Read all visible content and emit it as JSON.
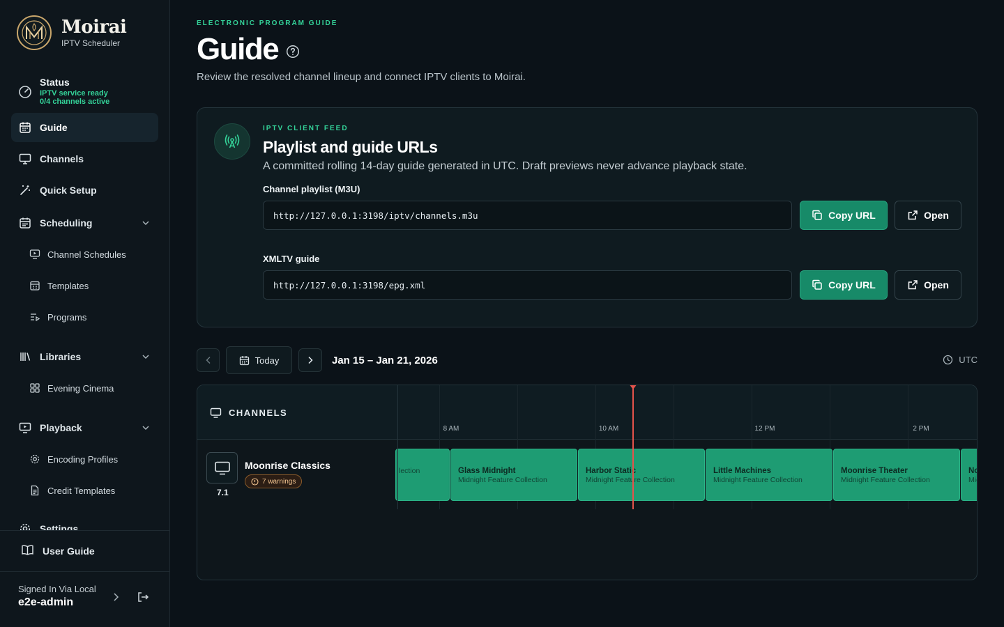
{
  "brand": {
    "name": "Moirai",
    "subtitle": "IPTV Scheduler"
  },
  "status": {
    "title": "Status",
    "line1": "IPTV service ready",
    "line2": "0/4 channels active"
  },
  "nav": {
    "guide": "Guide",
    "channels": "Channels",
    "quick_setup": "Quick Setup",
    "scheduling": "Scheduling",
    "channel_schedules": "Channel Schedules",
    "templates": "Templates",
    "programs": "Programs",
    "libraries": "Libraries",
    "evening_cinema": "Evening Cinema",
    "playback": "Playback",
    "encoding_profiles": "Encoding Profiles",
    "credit_templates": "Credit Templates",
    "settings": "Settings",
    "user_guide": "User Guide"
  },
  "account": {
    "label": "Signed In Via Local",
    "user": "e2e-admin"
  },
  "page": {
    "eyebrow": "ELECTRONIC PROGRAM GUIDE",
    "title": "Guide",
    "description": "Review the resolved channel lineup and connect IPTV clients to Moirai."
  },
  "feed": {
    "eyebrow": "IPTV CLIENT FEED",
    "title": "Playlist and guide URLs",
    "description": "A committed rolling 14-day guide generated in UTC. Draft previews never advance playback state.",
    "playlist_label": "Channel playlist (M3U)",
    "playlist_url": "http://127.0.0.1:3198/iptv/channels.m3u",
    "xmltv_label": "XMLTV guide",
    "xmltv_url": "http://127.0.0.1:3198/epg.xml",
    "copy_label": "Copy URL",
    "open_label": "Open"
  },
  "toolbar": {
    "today": "Today",
    "date_range": "Jan 15 – Jan 21, 2026",
    "timezone": "UTC"
  },
  "grid": {
    "channels_header": "CHANNELS",
    "time_labels": [
      "8 AM",
      "10 AM",
      "12 PM",
      "2 PM"
    ],
    "channel": {
      "name": "Moonrise Classics",
      "number": "7.1",
      "warnings": "7 warnings"
    },
    "programs": [
      {
        "title": "",
        "subtitle": "lection"
      },
      {
        "title": "Glass Midnight",
        "subtitle": "Midnight Feature Collection"
      },
      {
        "title": "Harbor Static",
        "subtitle": "Midnight Feature Collection"
      },
      {
        "title": "Little Machines",
        "subtitle": "Midnight Feature Collection"
      },
      {
        "title": "Moonrise Theater",
        "subtitle": "Midnight Feature Collection"
      },
      {
        "title": "No",
        "subtitle": "Mic"
      }
    ]
  },
  "colors": {
    "accent": "#34d399",
    "program": "#1e9c73",
    "now": "#e5534b",
    "warning": "#f1c38f"
  }
}
